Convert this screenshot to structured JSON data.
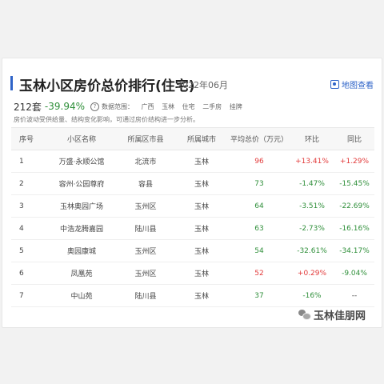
{
  "header": {
    "title": "玉林小区房价总价排行(住宅)",
    "date": "2022年06月",
    "map_link": "地图查看",
    "map_icon": "map-icon"
  },
  "summary": {
    "count": "212套",
    "change": "-39.94%",
    "scope_label": "数据范围：",
    "scope_items": [
      "广西",
      "玉林",
      "住宅",
      "二手房",
      "挂牌"
    ],
    "note": "房价波动受供给量、结构变化影响，可通过房价结构进一步分析。"
  },
  "table": {
    "headers": [
      "序号",
      "小区名称",
      "所属区市县",
      "所属城市",
      "平均总价（万元）",
      "环比",
      "同比"
    ],
    "rows": [
      {
        "rank": "1",
        "name": "万盛·永顺公馆",
        "district": "北流市",
        "city": "玉林",
        "price": "96",
        "mom": "+13.41%",
        "yoy": "+1.29%",
        "price_color": "red",
        "mom_color": "red",
        "yoy_color": "red"
      },
      {
        "rank": "2",
        "name": "容州·公园尊府",
        "district": "容县",
        "city": "玉林",
        "price": "73",
        "mom": "-1.47%",
        "yoy": "-15.45%",
        "price_color": "green",
        "mom_color": "green",
        "yoy_color": "green"
      },
      {
        "rank": "3",
        "name": "玉林奥园广场",
        "district": "玉州区",
        "city": "玉林",
        "price": "64",
        "mom": "-3.51%",
        "yoy": "-22.69%",
        "price_color": "green",
        "mom_color": "green",
        "yoy_color": "green"
      },
      {
        "rank": "4",
        "name": "中浩龙腾嘉园",
        "district": "陆川县",
        "city": "玉林",
        "price": "63",
        "mom": "-2.73%",
        "yoy": "-16.16%",
        "price_color": "green",
        "mom_color": "green",
        "yoy_color": "green"
      },
      {
        "rank": "5",
        "name": "奥园康城",
        "district": "玉州区",
        "city": "玉林",
        "price": "54",
        "mom": "-32.61%",
        "yoy": "-34.17%",
        "price_color": "green",
        "mom_color": "green",
        "yoy_color": "green"
      },
      {
        "rank": "6",
        "name": "凤凰苑",
        "district": "玉州区",
        "city": "玉林",
        "price": "52",
        "mom": "+0.29%",
        "yoy": "-9.04%",
        "price_color": "red",
        "mom_color": "red",
        "yoy_color": "green"
      },
      {
        "rank": "7",
        "name": "中山苑",
        "district": "陆川县",
        "city": "玉林",
        "price": "37",
        "mom": "-16%",
        "yoy": "--",
        "price_color": "green",
        "mom_color": "green",
        "yoy_color": "gray"
      }
    ]
  },
  "colors": {
    "accent": "#2f64c8",
    "up": "#e23b3b",
    "down": "#2f8f3a"
  },
  "watermark": {
    "icon": "wechat-icon",
    "text": "玉林佳朋网"
  }
}
